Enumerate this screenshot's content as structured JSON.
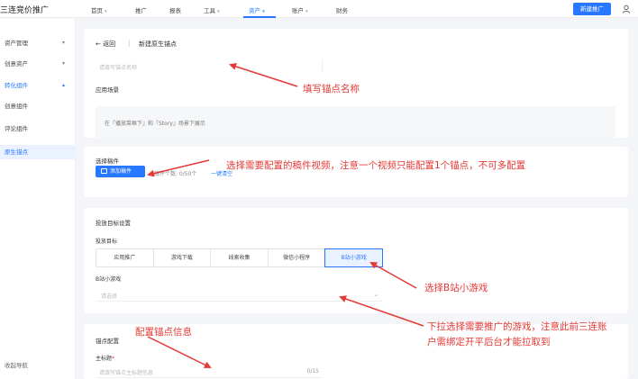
{
  "header": {
    "brand": "三连竞价推广",
    "nav": [
      {
        "label": "首页",
        "has_caret": true
      },
      {
        "label": "推广",
        "has_caret": false
      },
      {
        "label": "报表",
        "has_caret": false
      },
      {
        "label": "工具",
        "has_caret": true
      },
      {
        "label": "资产",
        "has_caret": true,
        "active": true
      },
      {
        "label": "账户",
        "has_caret": true
      },
      {
        "label": "财务",
        "has_caret": false
      }
    ],
    "new_button": "新建推广",
    "user_icon": "user-icon"
  },
  "sidebar": {
    "items": [
      {
        "label": "资产管理",
        "chevron": "▾"
      },
      {
        "label": "创意资产",
        "chevron": "▾"
      },
      {
        "label": "转化组件",
        "chevron": "▴"
      },
      {
        "label": "创意组件"
      },
      {
        "label": "评论组件"
      },
      {
        "label": "原生锚点"
      }
    ],
    "collapse_label": "收起导航"
  },
  "card1": {
    "back_label": "返回",
    "separator": "|",
    "page_title": "新建原生锚点",
    "name_placeholder": "请填写锚点名称",
    "scene_label": "应用场景",
    "scene_text": "在『播放菜框下』和『Story』场景下展示"
  },
  "card2": {
    "title": "选择稿件",
    "add_button": "添加稿件",
    "count_text": "稿件个数: 0/50个",
    "clear_link": "一键清空"
  },
  "card3": {
    "title": "投放目标设置",
    "target_label": "投放目标",
    "tabs": [
      "应用推广",
      "游戏下载",
      "线索收集",
      "微信小程序",
      "B站小游戏"
    ],
    "active_tab": "B站小游戏",
    "game_label": "B站小游戏",
    "game_placeholder": "请选择"
  },
  "card4": {
    "title": "锚点配置",
    "main_title_label": "主标题",
    "required_mark": "*",
    "main_title_placeholder": "请填写锚点主标题信息",
    "main_title_counter": "0/15"
  },
  "annotations": {
    "fill_name": "填写锚点名称",
    "select_video": "选择需要配置的稿件视频，注意一个视频只能配置1个锚点，不可多配置",
    "select_game": "选择B站小游戏",
    "dropdown_note_line1": "下拉选择需要推广的游戏，注意此前三连账",
    "dropdown_note_line2": "户需绑定开平后台才能拉取到",
    "config_info": "配置锚点信息"
  },
  "colors": {
    "accent": "#2878ff",
    "annotation": "#e53935"
  }
}
